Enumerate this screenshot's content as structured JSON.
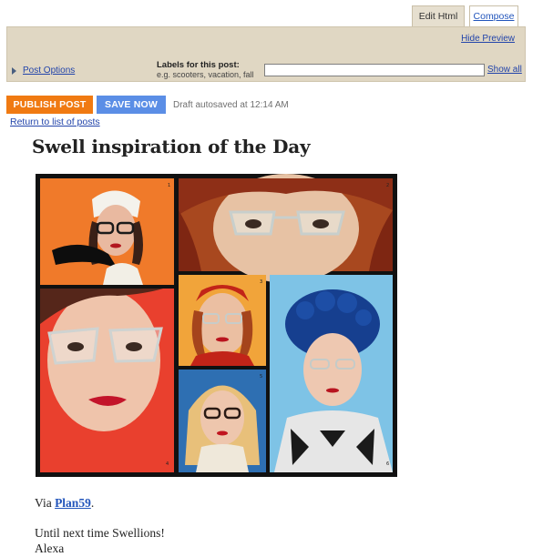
{
  "editor": {
    "tabs": [
      {
        "label": "Edit Html",
        "active": true
      },
      {
        "label": "Compose",
        "active": false
      }
    ],
    "hide_preview": "Hide Preview",
    "post_options": "Post Options",
    "labels": {
      "title": "Labels for this post:",
      "hint": "e.g. scooters, vacation, fall",
      "value": "",
      "show_all": "Show all"
    }
  },
  "actions": {
    "publish": "PUBLISH POST",
    "save": "SAVE NOW",
    "autosave_status": "Draft autosaved at 12:14 AM",
    "return_link": "Return to list of posts"
  },
  "post": {
    "title": "Swell inspiration of the Day",
    "image": {
      "panel_numbers": [
        "1",
        "2",
        "3",
        "4",
        "5",
        "6"
      ]
    },
    "via_prefix": "Via ",
    "via_link": "Plan59",
    "via_suffix": ".",
    "closing": "Until next time Swellions!",
    "signature": "Alexa"
  },
  "colors": {
    "publish": "#f07a12",
    "save": "#5b8ee6",
    "panel": "#e0d7c3",
    "link": "#2244aa"
  }
}
